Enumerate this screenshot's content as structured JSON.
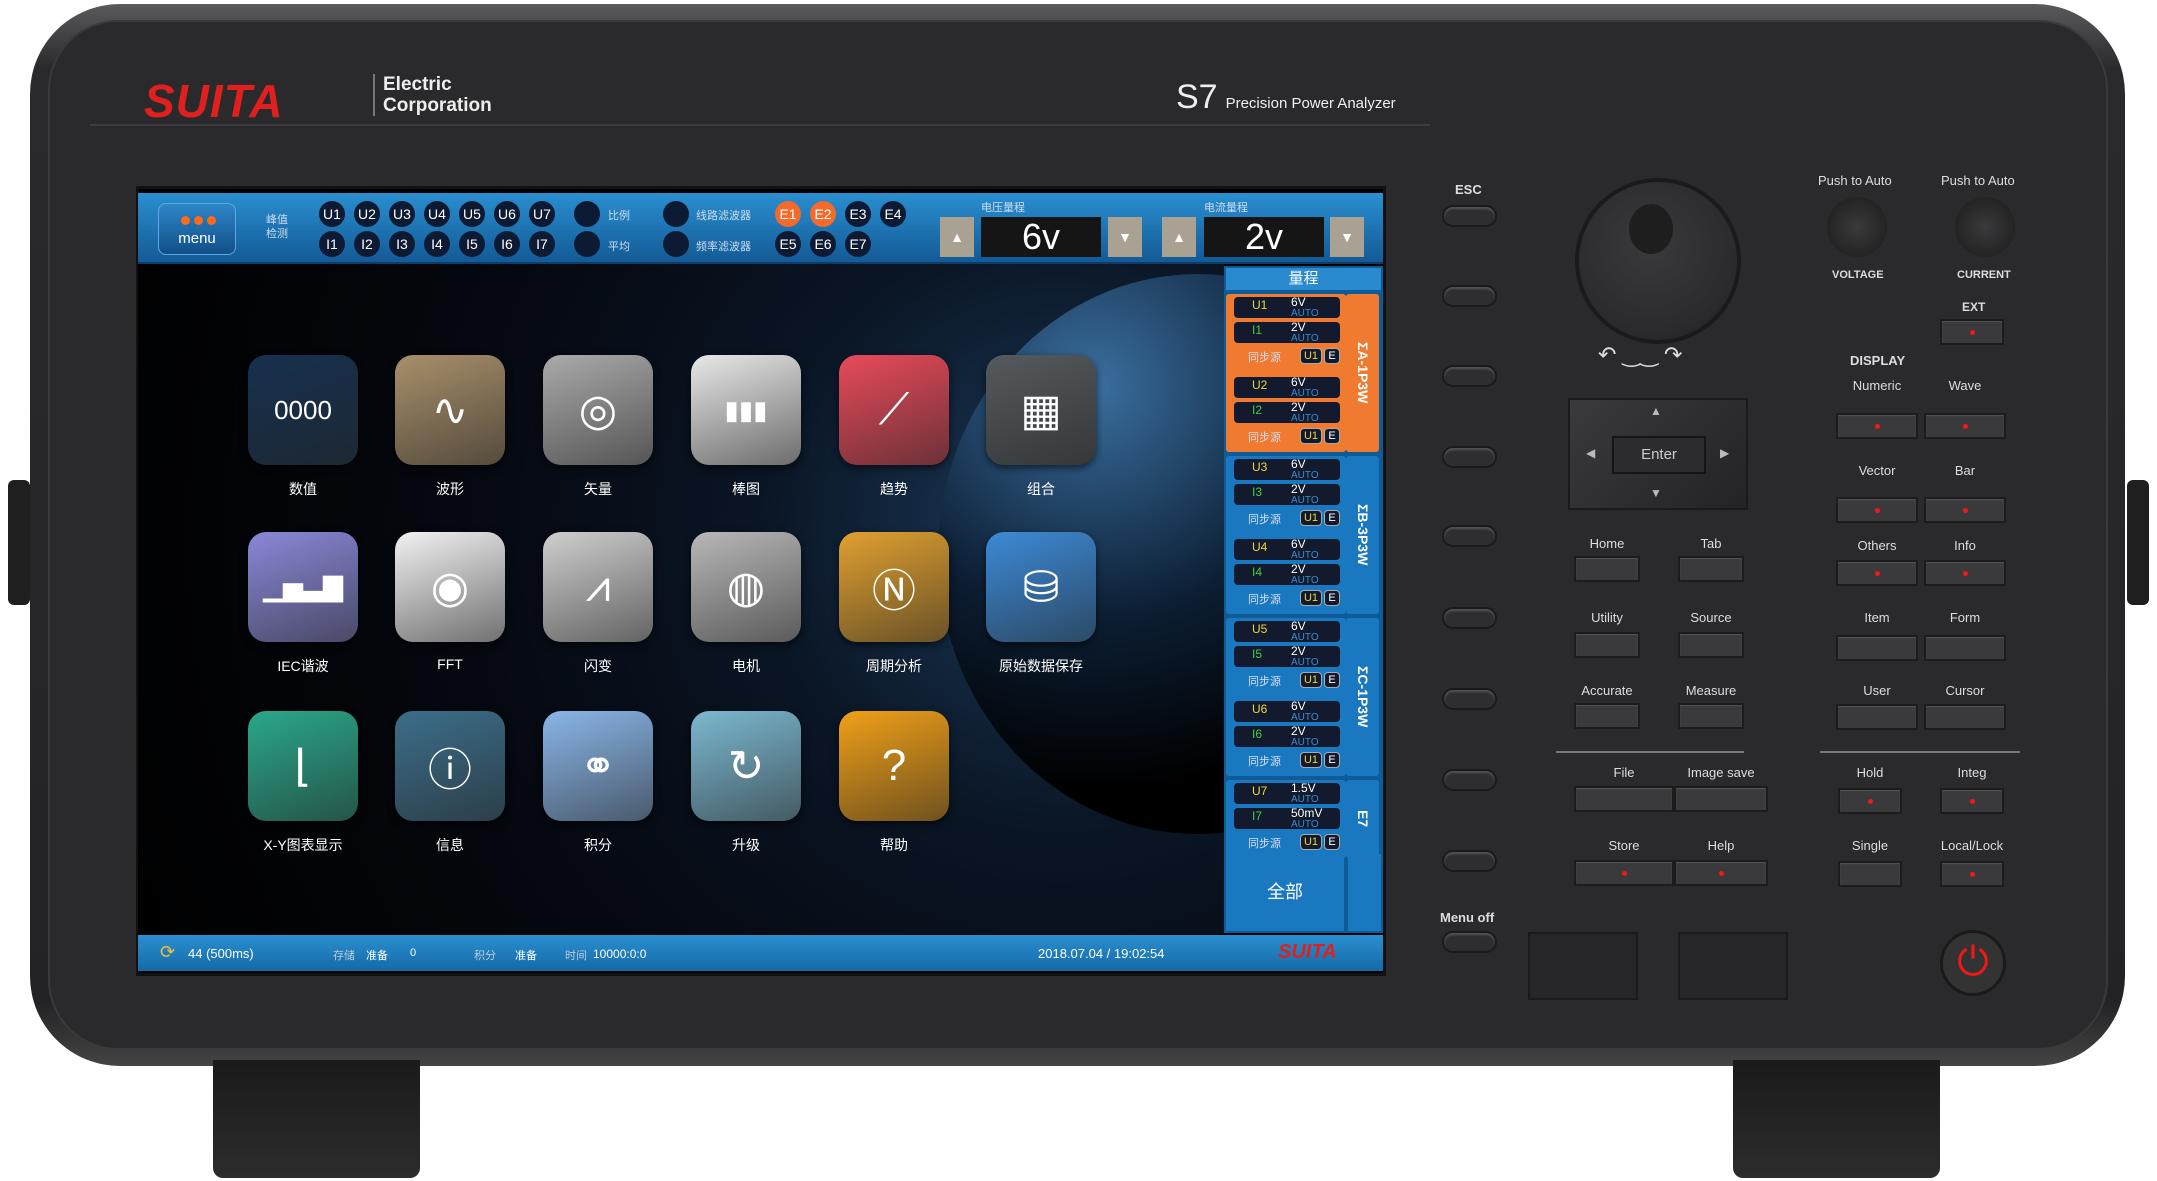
{
  "brand": {
    "logo": "SUITA",
    "company_line1": "Electric",
    "company_line2": "Corporation",
    "model": "S7",
    "model_desc": "Precision Power Analyzer"
  },
  "topbar": {
    "menu_label": "menu",
    "peak_label": "峰值检测",
    "u_channels": [
      "U1",
      "U2",
      "U3",
      "U4",
      "U5",
      "U6",
      "U7"
    ],
    "i_channels": [
      "I1",
      "I2",
      "I3",
      "I4",
      "I5",
      "I6",
      "I7"
    ],
    "ratio_label": "比例",
    "average_label": "平均",
    "line_filter_label": "线路滤波器",
    "freq_filter_label": "频率滤波器",
    "e_channels": [
      {
        "label": "E1",
        "active": true
      },
      {
        "label": "E2",
        "active": true
      },
      {
        "label": "E3",
        "active": false
      },
      {
        "label": "E4",
        "active": false
      },
      {
        "label": "E5",
        "active": false
      },
      {
        "label": "E6",
        "active": false
      },
      {
        "label": "E7",
        "active": false
      }
    ],
    "voltage_range_label": "电压量程",
    "voltage_range": "6v",
    "current_range_label": "电流量程",
    "current_range": "2v"
  },
  "apps": [
    {
      "label": "数值",
      "icon": "numeric-icon",
      "glyph": "0000",
      "color": "#16304f"
    },
    {
      "label": "波形",
      "icon": "waveform-icon",
      "glyph": "∿",
      "color": "#a88f6a"
    },
    {
      "label": "矢量",
      "icon": "vector-icon",
      "glyph": "◎",
      "color": "#aaaaaa"
    },
    {
      "label": "棒图",
      "icon": "bar-chart-icon",
      "glyph": "▮▮▮",
      "color": "#e8e8e8"
    },
    {
      "label": "趋势",
      "icon": "trend-icon",
      "glyph": "⟋",
      "color": "#e84a5a"
    },
    {
      "label": "组合",
      "icon": "combination-icon",
      "glyph": "▦",
      "color": "#555a5e"
    },
    {
      "label": "IEC谐波",
      "icon": "harmonic-icon",
      "glyph": "▁▅▃▇",
      "color": "#8a88d8"
    },
    {
      "label": "FFT",
      "icon": "fft-icon",
      "glyph": "◉",
      "color": "#f2f2f2"
    },
    {
      "label": "闪变",
      "icon": "flicker-icon",
      "glyph": "⩘",
      "color": "#cfcfcf"
    },
    {
      "label": "电机",
      "icon": "motor-icon",
      "glyph": "◍",
      "color": "#b8b8b8"
    },
    {
      "label": "周期分析",
      "icon": "cycle-analysis-icon",
      "glyph": "Ⓝ",
      "color": "#e0a030"
    },
    {
      "label": "原始数据保存",
      "icon": "database-icon",
      "glyph": "⛁",
      "color": "#3c8ad6"
    },
    {
      "label": "X-Y图表显示",
      "icon": "xy-chart-icon",
      "glyph": "⌊",
      "color": "#2aa88a"
    },
    {
      "label": "信息",
      "icon": "info-icon",
      "glyph": "ⓘ",
      "color": "#3c6e8a"
    },
    {
      "label": "积分",
      "icon": "integration-icon",
      "glyph": "⚭",
      "color": "#8ab6e8"
    },
    {
      "label": "升级",
      "icon": "upgrade-icon",
      "glyph": "↻",
      "color": "#7cb8d0"
    },
    {
      "label": "帮助",
      "icon": "help-icon",
      "glyph": "?",
      "color": "#f0a018"
    }
  ],
  "range_panel": {
    "title": "量程",
    "sync_label": "同步源",
    "all_label": "全部",
    "groups": [
      {
        "tag": "ΣA-1P3W",
        "color": "#f07a30",
        "channels": [
          {
            "u": "U1",
            "uv": "6V",
            "i": "I1",
            "iv": "2V"
          },
          {
            "u": "U2",
            "uv": "6V",
            "i": "I2",
            "iv": "2V"
          }
        ]
      },
      {
        "tag": "ΣB-3P3W",
        "color": "#1a78c0",
        "channels": [
          {
            "u": "U3",
            "uv": "6V",
            "i": "I3",
            "iv": "2V"
          },
          {
            "u": "U4",
            "uv": "6V",
            "i": "I4",
            "iv": "2V"
          }
        ]
      },
      {
        "tag": "ΣC-1P3W",
        "color": "#1a78c0",
        "channels": [
          {
            "u": "U5",
            "uv": "6V",
            "i": "I5",
            "iv": "2V"
          },
          {
            "u": "U6",
            "uv": "6V",
            "i": "I6",
            "iv": "2V"
          }
        ]
      },
      {
        "tag": "E7",
        "color": "#1a78c0",
        "channels": [
          {
            "u": "U7",
            "uv": "1.5V",
            "i": "I7",
            "iv": "50mV"
          }
        ]
      }
    ],
    "auto_label": "AUTO",
    "sync_source": "U1",
    "sync_e": "E"
  },
  "status": {
    "update": "44 (500ms)",
    "store_label": "存储",
    "store_state": "准备",
    "store_count": "0",
    "integ_label": "积分",
    "integ_state": "准备",
    "time_label": "时间",
    "time_value": "10000:0:0",
    "datetime": "2018.07.04 / 19:02:54",
    "logo": "SUITA"
  },
  "controls": {
    "esc": "ESC",
    "menu_off": "Menu off",
    "push_auto": "Push to Auto",
    "voltage": "VOLTAGE",
    "current": "CURRENT",
    "ext": "EXT",
    "display": "DISPLAY",
    "enter": "Enter",
    "keys": [
      {
        "label": "Numeric",
        "led": true
      },
      {
        "label": "Wave",
        "led": true
      },
      {
        "label": "Vector",
        "led": true
      },
      {
        "label": "Bar",
        "led": true
      },
      {
        "label": "Home",
        "led": false
      },
      {
        "label": "Tab",
        "led": false
      },
      {
        "label": "Others",
        "led": true
      },
      {
        "label": "Info",
        "led": true
      },
      {
        "label": "Utility",
        "led": false
      },
      {
        "label": "Source",
        "led": false
      },
      {
        "label": "Item",
        "led": false
      },
      {
        "label": "Form",
        "led": false
      },
      {
        "label": "Accurate",
        "led": false
      },
      {
        "label": "Measure",
        "led": false
      },
      {
        "label": "User",
        "led": false
      },
      {
        "label": "Cursor",
        "led": false
      },
      {
        "label": "File",
        "led": false
      },
      {
        "label": "Image save",
        "led": false
      },
      {
        "label": "Hold",
        "led": true
      },
      {
        "label": "Integ",
        "led": true
      },
      {
        "label": "Store",
        "led": true
      },
      {
        "label": "Help",
        "led": true
      },
      {
        "label": "Single",
        "led": false
      },
      {
        "label": "Local/Lock",
        "led": true
      }
    ]
  }
}
